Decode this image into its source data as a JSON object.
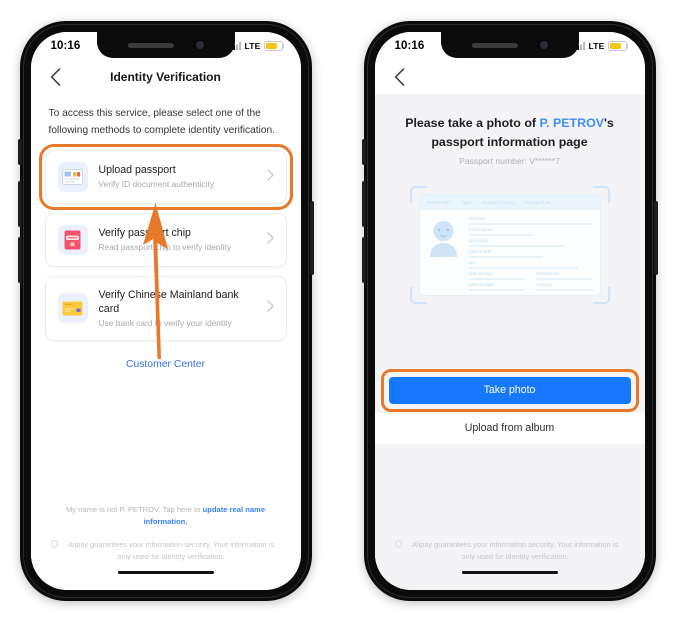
{
  "screens": [
    {
      "id": "identity-verification",
      "status_bar": {
        "time": "10:16",
        "network": "LTE"
      },
      "nav": {
        "title": "Identity Verification",
        "back_icon": "chevron-left-icon"
      },
      "intro": "To access this service, please select one of the following methods to complete identity verification.",
      "methods": [
        {
          "title": "Upload passport",
          "subtitle": "Verify ID document authenticity",
          "icon": "id-card-icon",
          "highlighted": true
        },
        {
          "title": "Verify passport chip",
          "subtitle": "Read passport chip to verify identity",
          "icon": "passport-book-icon",
          "highlighted": false
        },
        {
          "title": "Verify Chinese Mainland bank card",
          "subtitle": "Use bank card to verify your identity",
          "icon": "bank-card-icon",
          "highlighted": false
        }
      ],
      "customer_center": "Customer Center",
      "disclaimer_prefix": "My name is not P. PETROV. Tap here to ",
      "disclaimer_link": "update real name information.",
      "guarantee": "Alipay guarantees your information security, Your information is only used for identity verification."
    },
    {
      "id": "take-passport-photo",
      "status_bar": {
        "time": "10:16",
        "network": "LTE"
      },
      "nav": {
        "title": "",
        "back_icon": "chevron-left-icon"
      },
      "prompt": {
        "lead": "Please take a photo of ",
        "name": "P. PETROV",
        "trail": "'s passport information page",
        "subtitle": "Passport number: V******7"
      },
      "passport_preview": {
        "header_labels": [
          "PASSPORT",
          "Type",
          "Issuing Country",
          "Passport No"
        ],
        "field_labels": [
          "Surname",
          "Given names",
          "Nationality",
          "Date of birth",
          "Sex",
          "Date of issue",
          "Personal No",
          "Date of expiry",
          "Authority"
        ]
      },
      "buttons": {
        "take_photo": "Take photo",
        "upload_album": "Upload from album"
      },
      "guarantee": "Alipay guarantees your information security, Your information is only used for identity verification."
    }
  ],
  "annotations": {
    "arrows": [
      {
        "name": "arrow-to-upload-passport",
        "color": "#e8792a"
      },
      {
        "name": "arrow-to-take-photo",
        "color": "#e8792a"
      }
    ],
    "highlight_color": "#e8792a"
  }
}
